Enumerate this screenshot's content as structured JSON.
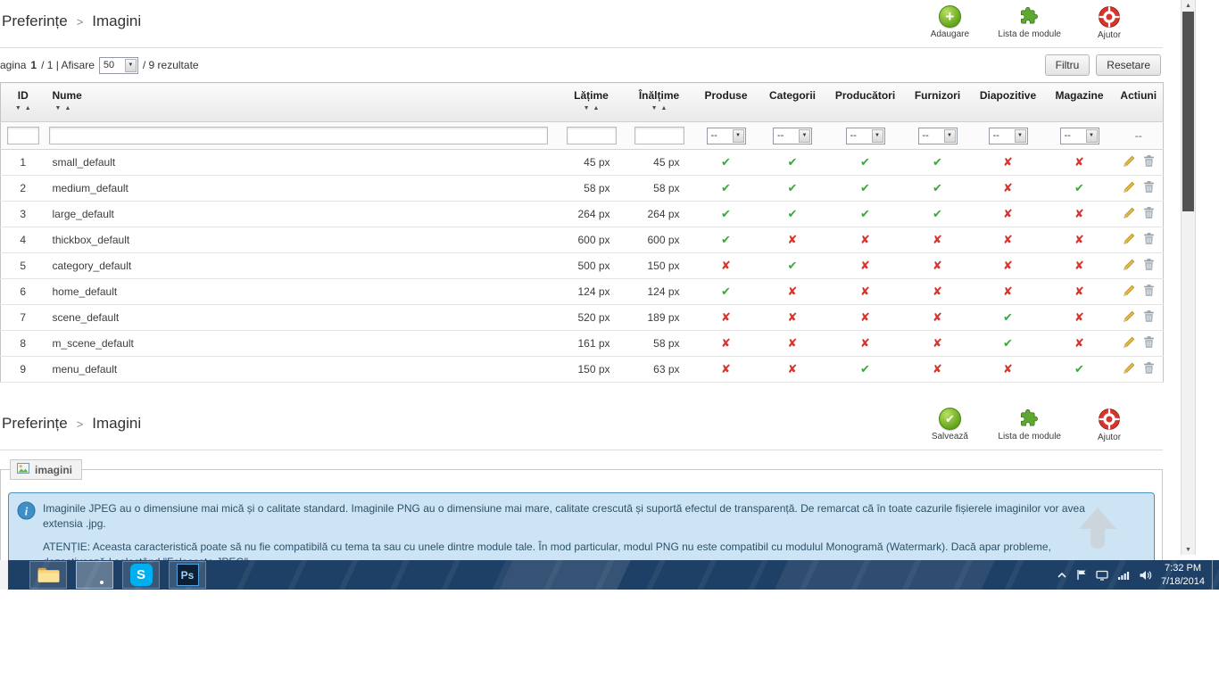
{
  "theme": {
    "check_green": "#3aa83a",
    "cross_red": "#d5352e",
    "action_green": "#63a41d",
    "help_red": "#d7352c",
    "info_box_bg": "#cde4f5",
    "info_box_border": "#4e8fc0",
    "taskbar_blue": "#1f4066"
  },
  "header": {
    "breadcrumb_root": "Preferințe",
    "breadcrumb_separator": ">",
    "breadcrumb_current": "Imagini",
    "actions": [
      {
        "id": "add",
        "label": "Adaugare",
        "icon": "add-icon"
      },
      {
        "id": "modules",
        "label": "Lista de module",
        "icon": "modules-icon"
      },
      {
        "id": "help",
        "label": "Ajutor",
        "icon": "help-icon"
      }
    ]
  },
  "toolbar": {
    "pagination_prefix": "agina",
    "current_page": "1",
    "pagination_mid": "/ 1 | Afisare",
    "page_size": "50",
    "pagination_suffix": "/ 9 rezultate",
    "filter_button": "Filtru",
    "reset_button": "Resetare"
  },
  "table": {
    "filter_select_value": "--",
    "actions_filter_placeholder": "--",
    "columns": [
      {
        "key": "id",
        "label": "ID",
        "sortable": true,
        "filter": "text"
      },
      {
        "key": "name",
        "label": "Nume",
        "sortable": true,
        "filter": "text"
      },
      {
        "key": "width",
        "label": "Lățime",
        "sortable": true,
        "filter": "text"
      },
      {
        "key": "height",
        "label": "Înălțime",
        "sortable": true,
        "filter": "text"
      },
      {
        "key": "products",
        "label": "Produse",
        "sortable": false,
        "filter": "select"
      },
      {
        "key": "categories",
        "label": "Categorii",
        "sortable": false,
        "filter": "select"
      },
      {
        "key": "manufacturers",
        "label": "Producători",
        "sortable": false,
        "filter": "select"
      },
      {
        "key": "suppliers",
        "label": "Furnizori",
        "sortable": false,
        "filter": "select"
      },
      {
        "key": "slides",
        "label": "Diapozitive",
        "sortable": false,
        "filter": "select"
      },
      {
        "key": "stores",
        "label": "Magazine",
        "sortable": false,
        "filter": "select"
      },
      {
        "key": "actions",
        "label": "Actiuni",
        "sortable": false,
        "filter": "dash"
      }
    ],
    "rows": [
      {
        "id": "1",
        "name": "small_default",
        "width": "45 px",
        "height": "45 px",
        "flags": [
          true,
          true,
          true,
          true,
          false,
          false
        ]
      },
      {
        "id": "2",
        "name": "medium_default",
        "width": "58 px",
        "height": "58 px",
        "flags": [
          true,
          true,
          true,
          true,
          false,
          true
        ]
      },
      {
        "id": "3",
        "name": "large_default",
        "width": "264 px",
        "height": "264 px",
        "flags": [
          true,
          true,
          true,
          true,
          false,
          false
        ]
      },
      {
        "id": "4",
        "name": "thickbox_default",
        "width": "600 px",
        "height": "600 px",
        "flags": [
          true,
          false,
          false,
          false,
          false,
          false
        ]
      },
      {
        "id": "5",
        "name": "category_default",
        "width": "500 px",
        "height": "150 px",
        "flags": [
          false,
          true,
          false,
          false,
          false,
          false
        ]
      },
      {
        "id": "6",
        "name": "home_default",
        "width": "124 px",
        "height": "124 px",
        "flags": [
          true,
          false,
          false,
          false,
          false,
          false
        ]
      },
      {
        "id": "7",
        "name": "scene_default",
        "width": "520 px",
        "height": "189 px",
        "flags": [
          false,
          false,
          false,
          false,
          true,
          false
        ]
      },
      {
        "id": "8",
        "name": "m_scene_default",
        "width": "161 px",
        "height": "58 px",
        "flags": [
          false,
          false,
          false,
          false,
          true,
          false
        ]
      },
      {
        "id": "9",
        "name": "menu_default",
        "width": "150 px",
        "height": "63 px",
        "flags": [
          false,
          false,
          true,
          false,
          false,
          true
        ]
      }
    ]
  },
  "section2": {
    "breadcrumb_root": "Preferințe",
    "breadcrumb_separator": ">",
    "breadcrumb_current": "Imagini",
    "actions": [
      {
        "id": "save",
        "label": "Salvează",
        "icon": "save-icon"
      },
      {
        "id": "modules",
        "label": "Lista de module",
        "icon": "modules-icon"
      },
      {
        "id": "help",
        "label": "Ajutor",
        "icon": "help-icon"
      }
    ]
  },
  "panel": {
    "legend": "imagini",
    "info": {
      "paragraph1": "Imaginile JPEG au o dimensiune mai mică și o calitate standard. Imaginile PNG au o dimensiune mai mare, calitate crescută și suportă efectul de transparență. De remarcat că în toate cazurile fișierele imaginilor vor avea extensia .jpg.",
      "paragraph2": "ATENȚIE: Aceasta caracteristică poate să nu fie compatibilă cu tema ta sau cu unele dintre module tale. În mod particular, modul PNG nu este compatibil cu modulul Monogramă (Watermark). Dacă apar probleme, dezactivează-l selectând \"Folosește JPEG\"."
    }
  },
  "taskbar": {
    "apps": [
      {
        "id": "explorer",
        "icon": "file-explorer-icon"
      },
      {
        "id": "chrome",
        "icon": "chrome-icon",
        "active": true
      },
      {
        "id": "skype",
        "icon": "skype-icon",
        "label": "S"
      },
      {
        "id": "photoshop",
        "icon": "photoshop-icon",
        "label": "Ps"
      }
    ],
    "tray_icons": [
      "hidden-icons-chevron-icon",
      "flag-icon",
      "touch-keyboard-icon",
      "network-signal-icon",
      "volume-icon"
    ],
    "clock_time": "7:32 PM",
    "clock_date": "7/18/2014"
  }
}
